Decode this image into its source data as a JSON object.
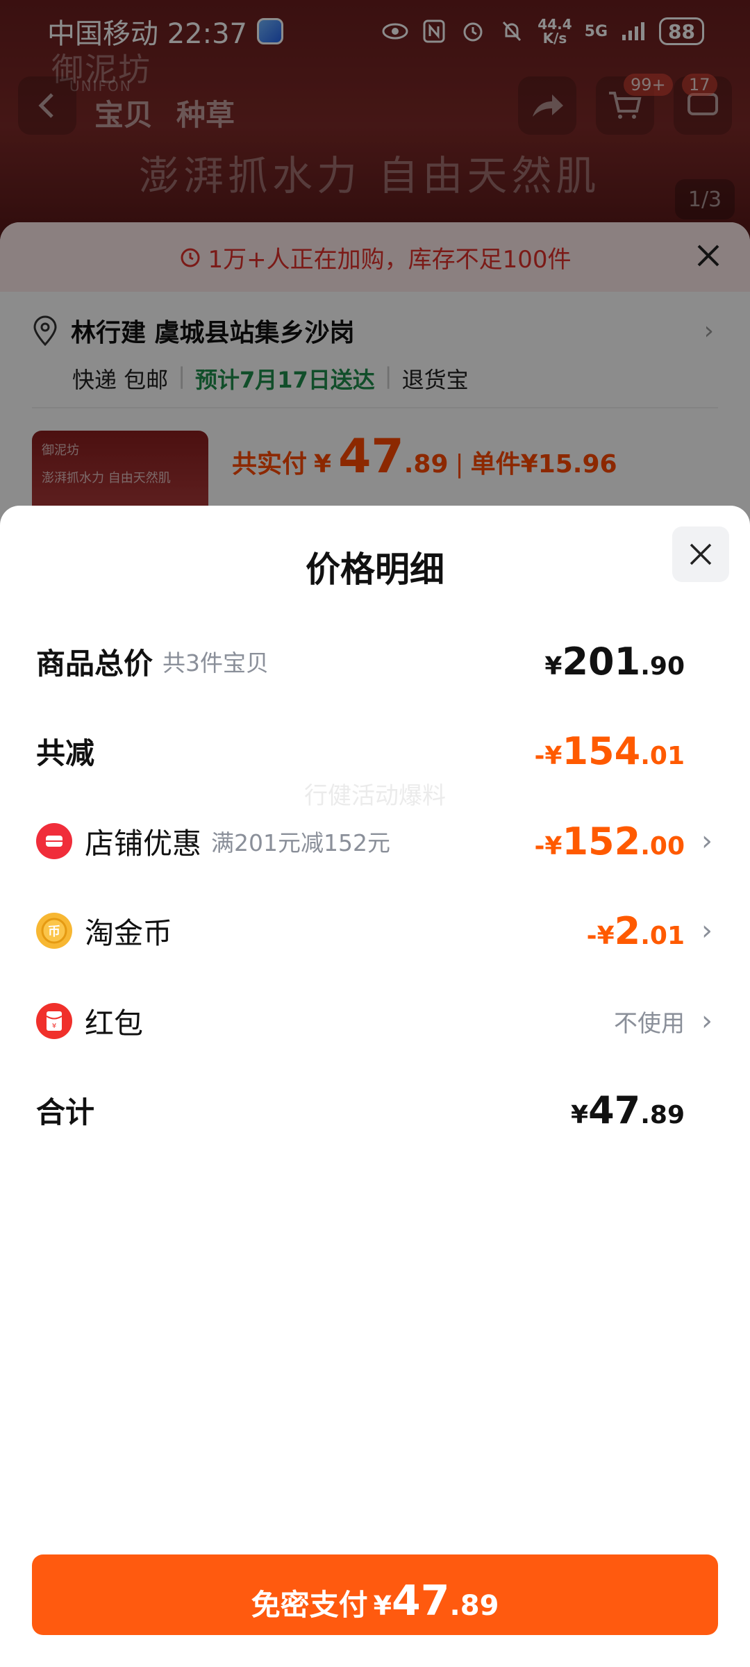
{
  "status_bar": {
    "carrier_time": "中国移动 22:37",
    "net_speed_value": "44.4",
    "net_speed_unit": "K/s",
    "network": "5G",
    "battery": "88"
  },
  "background": {
    "brand_logo": "御泥坊",
    "brand_sub": "UNIFON",
    "tab_baobei": "宝贝",
    "tab_zhongcao": "种草",
    "cart_badge": "99+",
    "msg_badge": "17",
    "hero_text": "澎湃抓水力 自由天然肌",
    "image_counter": "1/3",
    "stock_banner": "1万+人正在加购，库存不足100件",
    "address": "林行建 虞城县站集乡沙岗",
    "shipping": "快递 包邮",
    "delivery_estimate": "预计7月17日送达",
    "return_service": "退货宝",
    "thumb_brand": "御泥坊",
    "thumb_text": "澎湃抓水力 自由天然肌",
    "paid_label": "共实付",
    "paid_prefix": "¥",
    "paid_int": "47",
    "paid_dec": ".89",
    "unit_price": "单件¥15.96"
  },
  "modal": {
    "title": "价格明细",
    "rows": {
      "total": {
        "label": "商品总价",
        "sub": "共3件宝贝",
        "prefix": "¥",
        "int": "201",
        "dec": ".90"
      },
      "reduction": {
        "label": "共减",
        "prefix": "-¥",
        "int": "154",
        "dec": ".01"
      },
      "store_discount": {
        "label": "店铺优惠",
        "sub": "满201元减152元",
        "prefix": "-¥",
        "int": "152",
        "dec": ".00"
      },
      "taojinbi": {
        "label": "淘金币",
        "prefix": "-¥",
        "int": "2",
        "dec": ".01"
      },
      "hongbao": {
        "label": "红包",
        "value": "不使用"
      },
      "subtotal": {
        "label": "合计",
        "prefix": "¥",
        "int": "47",
        "dec": ".89"
      }
    },
    "watermark": "行健活动爆料"
  },
  "pay_button": {
    "label": "免密支付",
    "prefix": "¥",
    "int": "47",
    "dec": ".89"
  },
  "colors": {
    "accent": "#ff5a0f",
    "discount": "#ff5a00",
    "muted": "#8a8f99",
    "green": "#1f8f4e"
  }
}
